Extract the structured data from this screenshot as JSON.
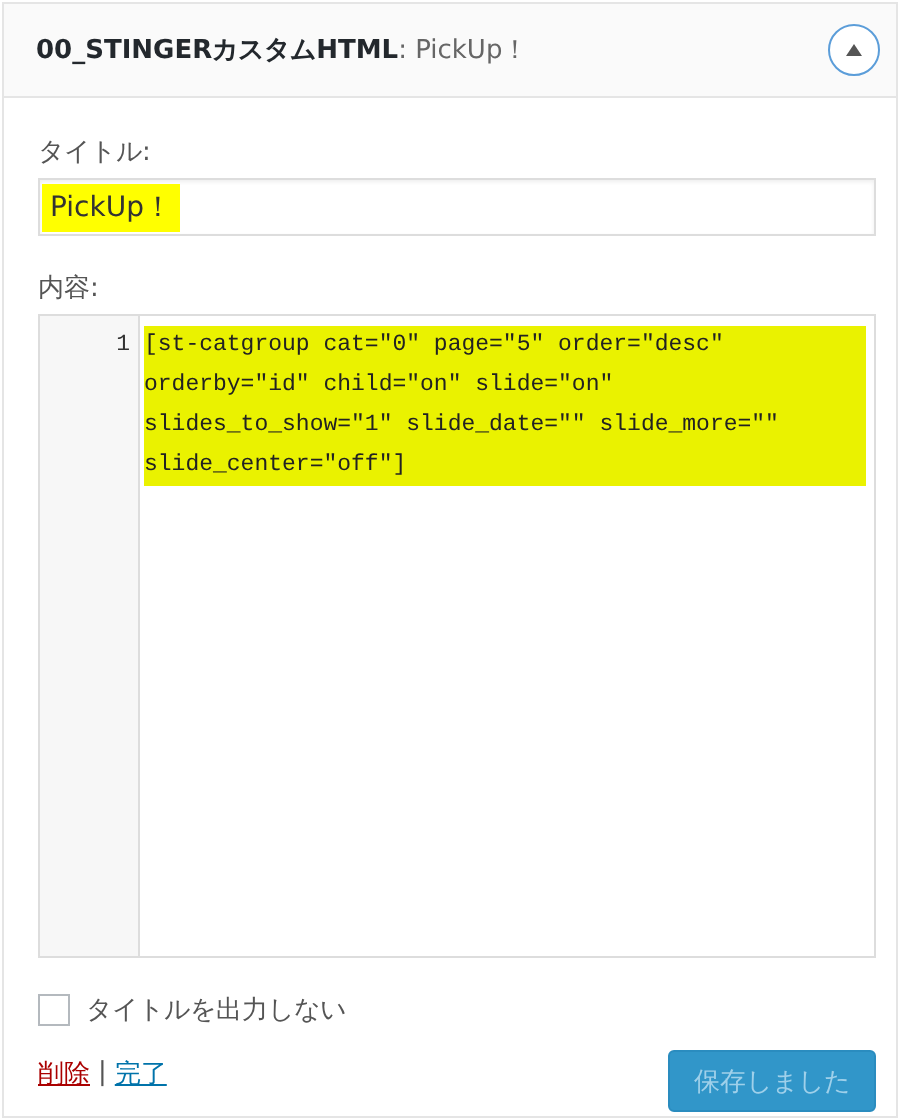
{
  "widget": {
    "title": "00_STINGERカスタムHTML",
    "subtitle": ": PickUp！",
    "expanded": true
  },
  "title_field": {
    "label": "タイトル:",
    "value": "PickUp！",
    "highlighted": true
  },
  "content": {
    "label": "内容:",
    "lines": [
      {
        "number": "1",
        "text": "[st-catgroup cat=\"0\" page=\"5\" order=\"desc\" orderby=\"id\" child=\"on\" slide=\"on\" slides_to_show=\"1\" slide_date=\"\" slide_more=\"\" slide_center=\"off\"]",
        "highlighted": true
      }
    ]
  },
  "hide_title": {
    "label": "タイトルを出力しない",
    "checked": false
  },
  "links": [
    {
      "kind": "delete",
      "label": "削除"
    },
    {
      "kind": "separator",
      "label": "|"
    },
    {
      "kind": "done",
      "label": "完了"
    }
  ],
  "save_button": {
    "label": "保存しました",
    "disabled": true
  }
}
